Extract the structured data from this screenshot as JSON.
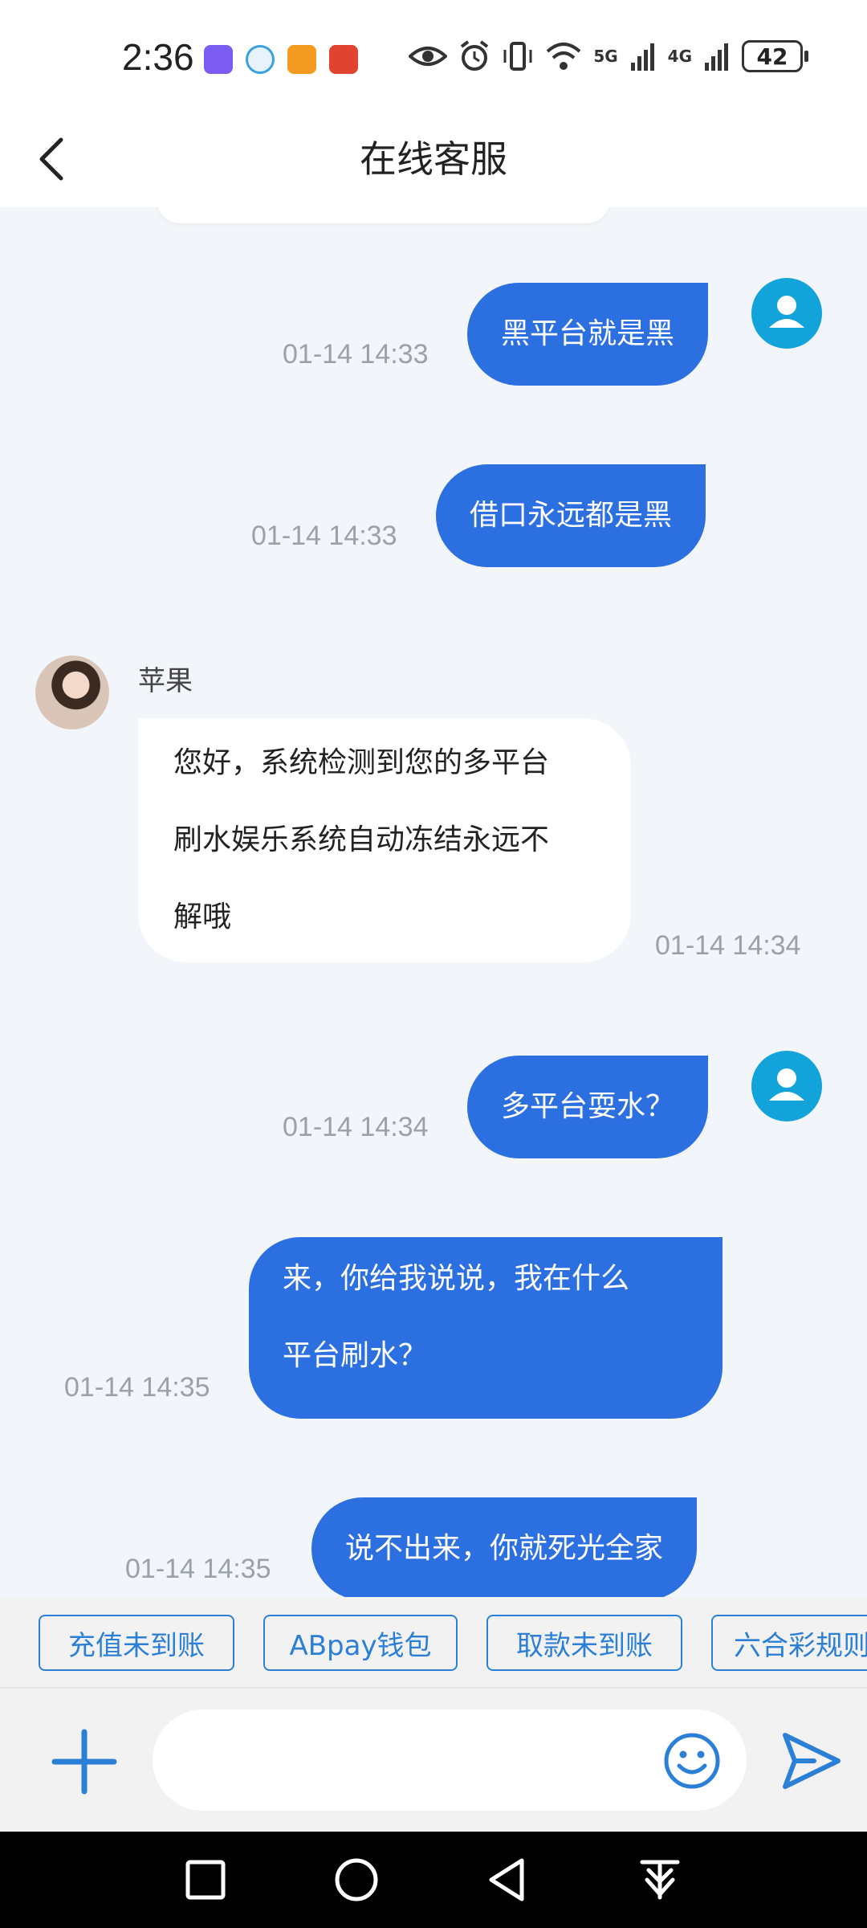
{
  "status_bar": {
    "time": "2:36",
    "battery": "42",
    "net1": "5G",
    "net2": "4G",
    "icons": [
      "eye-icon",
      "alarm-icon",
      "vibrate-icon",
      "wifi-icon",
      "signal-icon",
      "signal-icon"
    ]
  },
  "header": {
    "title": "在线客服"
  },
  "messages": [
    {
      "dir": "out",
      "lines": [
        "黑平台就是黑"
      ],
      "time": "01-14 14:33"
    },
    {
      "dir": "out",
      "lines": [
        "借口永远都是黑"
      ],
      "time": "01-14 14:33"
    },
    {
      "dir": "in",
      "sender": "苹果",
      "lines": [
        "您好，系统检测到您的多平台",
        "刷水娱乐系统自动冻结永远不",
        "解哦"
      ],
      "time": "01-14 14:34"
    },
    {
      "dir": "out",
      "lines": [
        "多平台耍水？"
      ],
      "time": "01-14 14:34"
    },
    {
      "dir": "out",
      "lines": [
        "来，你给我说说，我在什么",
        "平台刷水？"
      ],
      "time": "01-14 14:35"
    },
    {
      "dir": "out",
      "lines": [
        "说不出来，你就死光全家"
      ],
      "time": "01-14 14:35"
    }
  ],
  "quick_replies": [
    "充值未到账",
    "ABpay钱包",
    "取款未到账",
    "六合彩规则"
  ],
  "input": {
    "placeholder": ""
  },
  "colors": {
    "accent": "#2c6fe0",
    "chip": "#2c7fd6",
    "avatar": "#12a3db",
    "background": "#f2f5f9"
  }
}
